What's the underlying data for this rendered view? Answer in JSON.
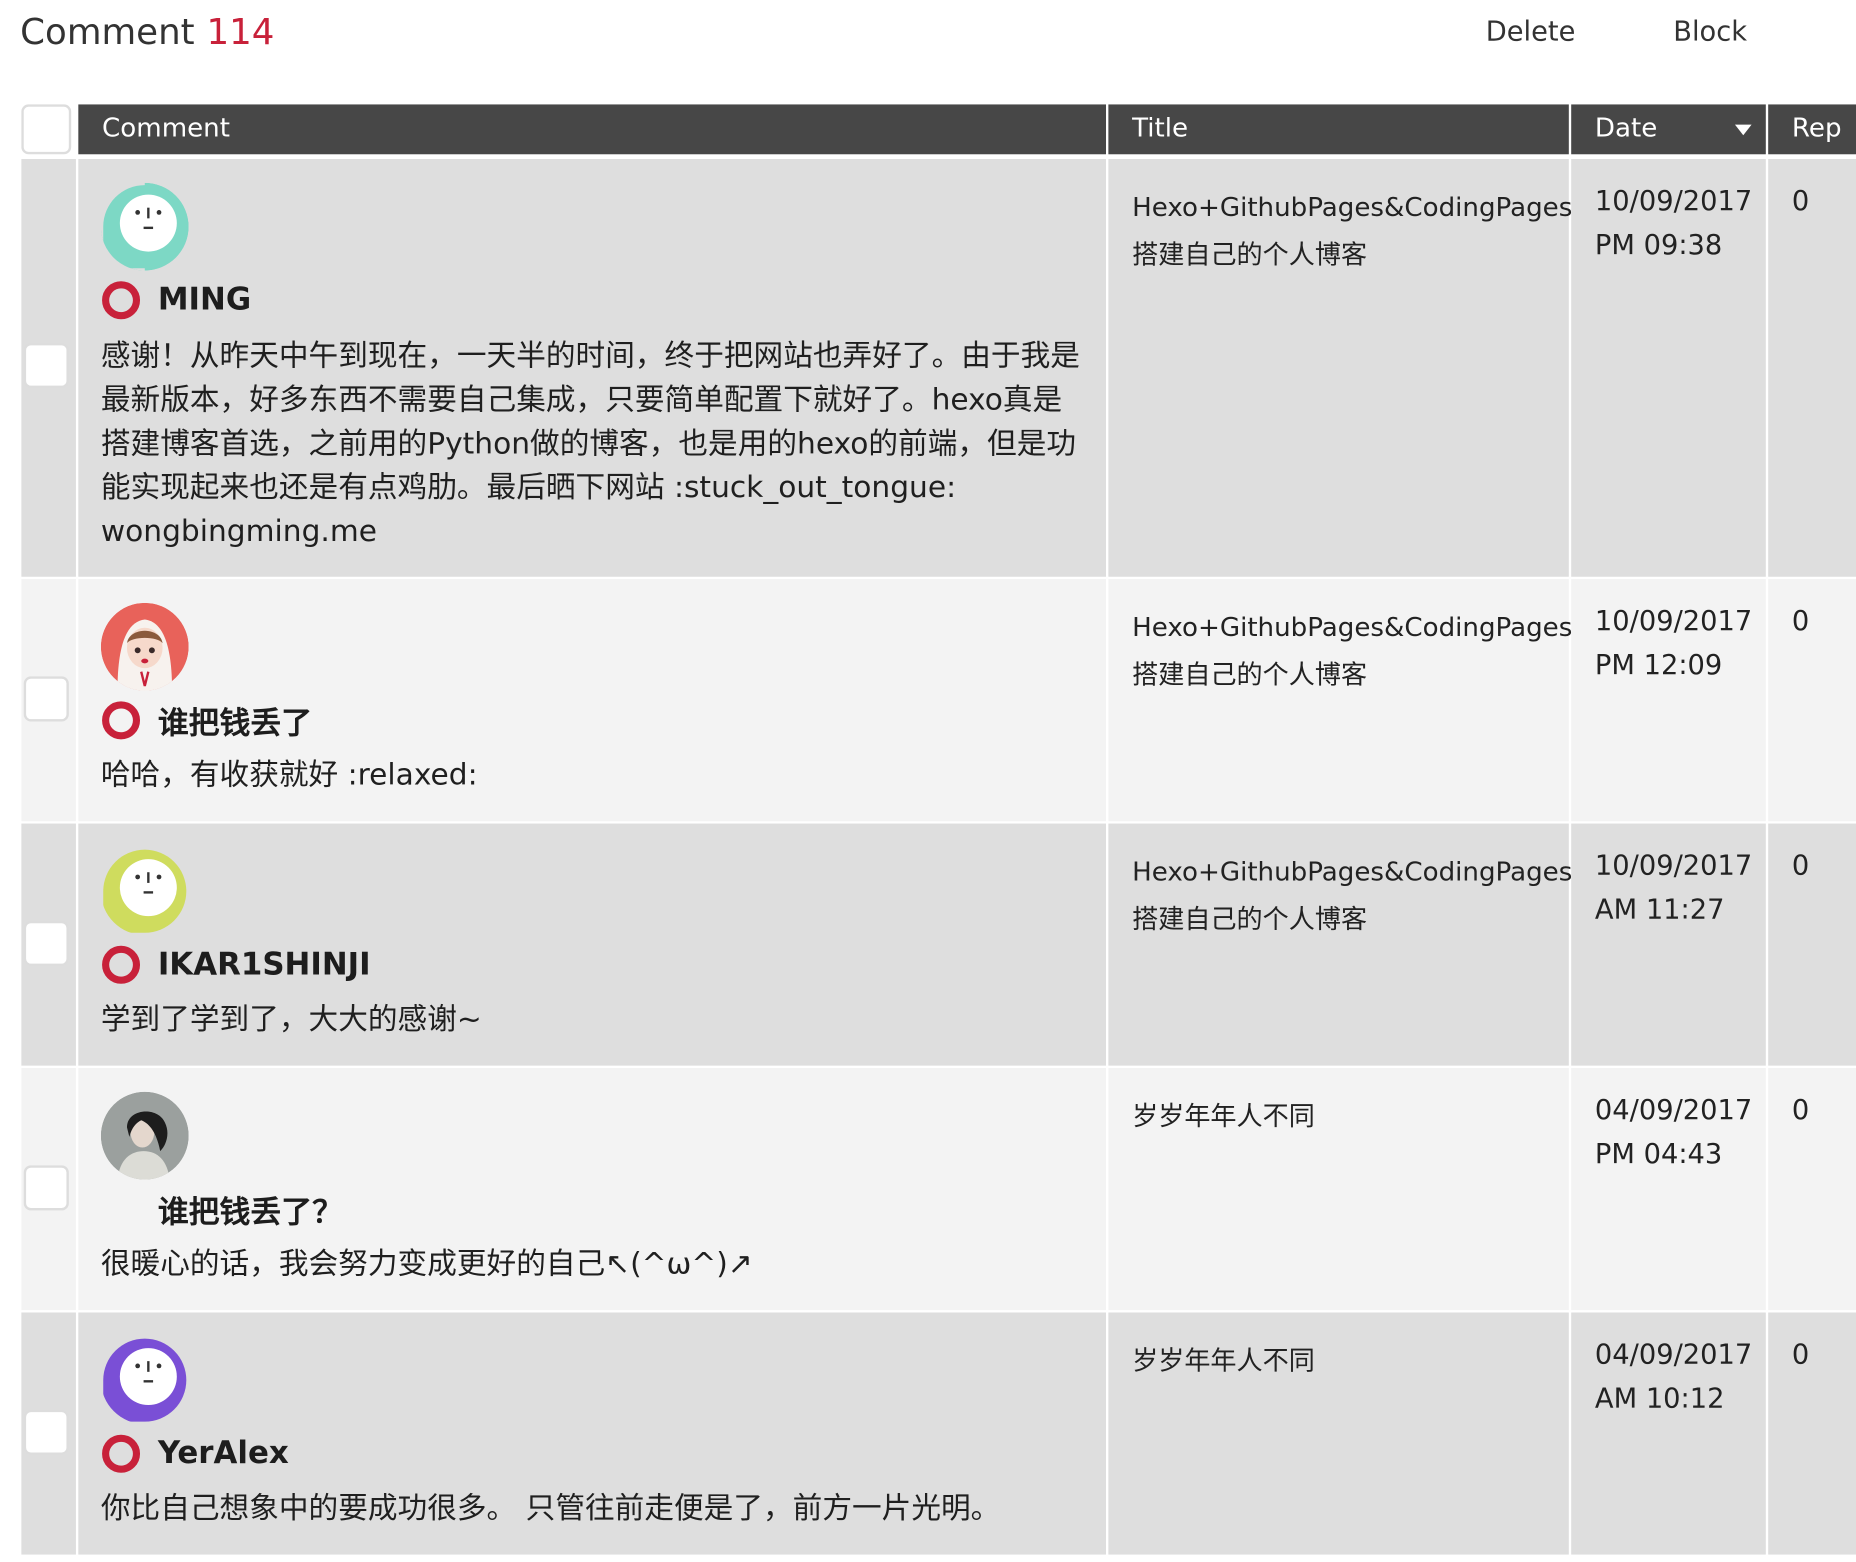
{
  "header": {
    "title": "Comment",
    "count": "114",
    "delete_label": "Delete",
    "block_label": "Block"
  },
  "table": {
    "columns": [
      "Comment",
      "Title",
      "Date",
      "Rep"
    ]
  },
  "rows": [
    {
      "username": "MING",
      "comment": "感谢！从昨天中午到现在，一天半的时间，终于把网站也弄好了。由于我是最新版本，好多东西不需要自己集成，只要简单配置下就好了。hexo真是搭建博客首选，之前用的Python做的博客，也是用的hexo的前端，但是功能实现起来也还是有点鸡肋。最后晒下网站 :stuck_out_tongue: wongbingming.me",
      "title": "Hexo+GithubPages&CodingPages 搭建自己的个人博客",
      "date": "10/09/2017",
      "time": "PM 09:38",
      "replies": "0",
      "avatar_icon": "default-face-teal",
      "avatar_color": "#7dd8c5"
    },
    {
      "username": "谁把钱丢了",
      "comment": "哈哈，有收获就好 :relaxed:",
      "title": "Hexo+GithubPages&CodingPages 搭建自己的个人博客",
      "date": "10/09/2017",
      "time": "PM 12:09",
      "replies": "0",
      "avatar_icon": "anime-girl-hoodie",
      "avatar_color": "#e8625a"
    },
    {
      "username": "IKAR1SHINJI",
      "comment": "学到了学到了，大大的感谢~",
      "title": "Hexo+GithubPages&CodingPages 搭建自己的个人博客",
      "date": "10/09/2017",
      "time": "AM 11:27",
      "replies": "0",
      "avatar_icon": "default-face-lime",
      "avatar_color": "#cfdc5e"
    },
    {
      "username": "谁把钱丢了？",
      "comment": "很暖心的话，我会努力变成更好的自己↖(^ω^)↗",
      "title": "岁岁年年人不同",
      "date": "04/09/2017",
      "time": "PM 04:43",
      "replies": "0",
      "avatar_icon": "photo-woman-profile",
      "avatar_color": "#8a8a8a"
    },
    {
      "username": "YerAlex",
      "comment": "你比自己想象中的要成功很多。 只管往前走便是了，前方一片光明。",
      "title": "岁岁年年人不同",
      "date": "04/09/2017",
      "time": "AM 10:12",
      "replies": "0",
      "avatar_icon": "default-face-purple",
      "avatar_color": "#7a4fd6"
    }
  ],
  "colors": {
    "accent": "#c8213a",
    "header_bg": "#474747",
    "row_dark": "#dedede",
    "row_light": "#f3f3f3"
  }
}
